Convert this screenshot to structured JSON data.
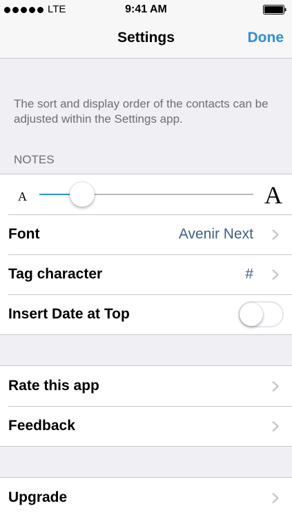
{
  "status_bar": {
    "carrier": "LTE",
    "time": "9:41 AM",
    "signal_bars": 5,
    "battery_level": 1.0
  },
  "nav": {
    "title": "Settings",
    "done_label": "Done"
  },
  "info_text": "The sort and display order of the contacts can be adjusted within the Settings app.",
  "notes_section": {
    "header": "NOTES",
    "font_size_slider": {
      "small_label": "A",
      "large_label": "A",
      "value": 0.2
    },
    "font": {
      "label": "Font",
      "value": "Avenir Next"
    },
    "tag_character": {
      "label": "Tag character",
      "value": "#"
    },
    "insert_date": {
      "label": "Insert Date at Top",
      "on": false
    }
  },
  "app_section": {
    "rate": {
      "label": "Rate this app"
    },
    "feedback": {
      "label": "Feedback"
    }
  },
  "upgrade_section": {
    "upgrade": {
      "label": "Upgrade"
    }
  },
  "colors": {
    "accent": "#2f8ddb",
    "value_text": "#3f5f8a",
    "background": "#efeff4",
    "secondary_text": "#6d6d72"
  }
}
